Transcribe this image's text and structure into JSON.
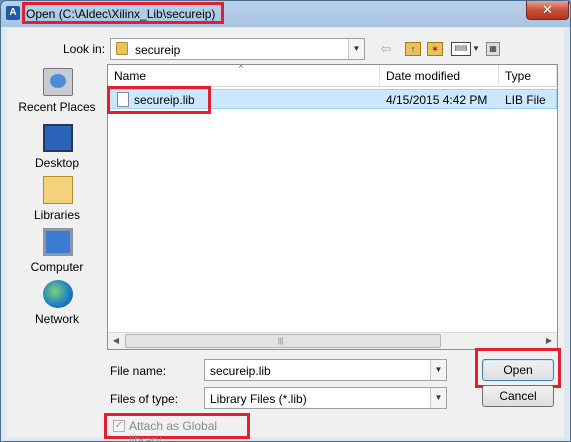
{
  "window": {
    "title": "Open (C:\\Aldec\\Xilinx_Lib\\secureip)",
    "app_icon": "A",
    "close_label": "✕"
  },
  "lookin": {
    "label": "Look in:",
    "value": "secureip"
  },
  "places": [
    {
      "label": "Recent Places",
      "icon": "recent-places-icon"
    },
    {
      "label": "Desktop",
      "icon": "desktop-icon"
    },
    {
      "label": "Libraries",
      "icon": "libraries-icon"
    },
    {
      "label": "Computer",
      "icon": "computer-icon"
    },
    {
      "label": "Network",
      "icon": "network-icon"
    }
  ],
  "list": {
    "columns": {
      "name": "Name",
      "date": "Date modified",
      "type": "Type"
    },
    "rows": [
      {
        "name": "secureip.lib",
        "date": "4/15/2015 4:42 PM",
        "type": "LIB File"
      }
    ]
  },
  "filename": {
    "label": "File name:",
    "value": "secureip.lib"
  },
  "filetype": {
    "label": "Files of type:",
    "value": "Library Files (*.lib)"
  },
  "attach": {
    "label": "Attach as Global library",
    "checked": true,
    "disabled": true
  },
  "buttons": {
    "open": "Open",
    "cancel": "Cancel"
  },
  "highlight_color": "#e0202a"
}
